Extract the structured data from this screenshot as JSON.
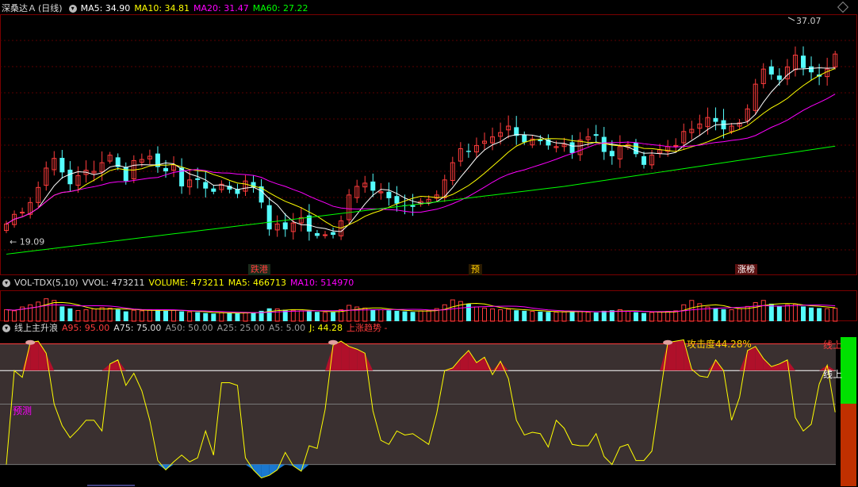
{
  "header": {
    "stock_name": "深桑达Ａ",
    "period": "(日线)",
    "ma5": "MA5: 34.90",
    "ma10": "MA10: 34.81",
    "ma20": "MA20: 31.47",
    "ma60": "MA60: 27.22"
  },
  "price_panel": {
    "high_label": "37.07",
    "low_label": "19.09",
    "events": [
      "跌港",
      "预",
      "涨榜"
    ]
  },
  "volume_header": {
    "indicator": "VOL-TDX(5,10)",
    "vvol": "VVOL: 473211",
    "volume": "VOLUME: 473211",
    "ma5": "MA5: 466713",
    "ma10": "MA10: 514970"
  },
  "indicator_header": {
    "name": "线上主升浪",
    "a95": "A95: 95.00",
    "a75": "A75: 75.00",
    "a50": "A50: 50.00",
    "a25": "A25: 25.00",
    "a5": "A5: 5.00",
    "j": "J: 44.28",
    "trend": "上涨趋势 -"
  },
  "indicator_panel": {
    "attack_label": "攻击度44.28%",
    "line_top_label": "线上",
    "line_label": "线上",
    "predict_label": "预测"
  },
  "colors": {
    "up": "#ff3c3c",
    "down": "#54fcfc",
    "ma5": "#ffffff",
    "ma10": "#ffff00",
    "ma20": "#ff00ff",
    "ma60": "#00ff00"
  },
  "chart_data": {
    "type": "candlestick",
    "price_ylim": [
      17,
      40
    ],
    "closes": [
      20.8,
      21.7,
      21.9,
      22.8,
      24.2,
      26.0,
      26.9,
      25.6,
      24.5,
      25.3,
      25.8,
      25.7,
      26.5,
      27.2,
      26.1,
      24.8,
      26.7,
      26.8,
      27.1,
      26.1,
      25.7,
      26.3,
      24.3,
      24.9,
      24.9,
      24.1,
      23.8,
      24.5,
      24.0,
      23.6,
      24.8,
      24.2,
      22.8,
      20.3,
      20.8,
      20.3,
      20.9,
      21.4,
      20.1,
      19.7,
      19.8,
      19.8,
      21.1,
      23.5,
      24.3,
      24.6,
      23.9,
      23.8,
      23.2,
      22.7,
      22.5,
      22.4,
      22.9,
      23.1,
      23.5,
      24.9,
      26.5,
      27.8,
      27.5,
      28.1,
      28.5,
      28.9,
      29.3,
      29.9,
      29.0,
      28.4,
      28.7,
      28.5,
      28.1,
      28.0,
      28.2,
      27.4,
      28.6,
      28.9,
      29.0,
      27.5,
      27.1,
      28.0,
      28.2,
      27.3,
      26.3,
      27.2,
      27.7,
      28.0,
      28.1,
      29.4,
      29.6,
      30.1,
      30.7,
      30.3,
      29.6,
      29.9,
      30.2,
      31.5,
      33.8,
      35.2,
      34.7,
      34.2,
      35.4,
      36.5,
      35.3,
      34.9,
      34.5,
      35.2,
      36.6
    ],
    "volume_ylim": [
      0,
      1100000
    ],
    "volumes": [
      420000,
      380000,
      520000,
      600000,
      700000,
      820000,
      760000,
      540000,
      470000,
      390000,
      420000,
      450000,
      500000,
      480000,
      430000,
      360000,
      400000,
      380000,
      420000,
      410000,
      380000,
      400000,
      360000,
      340000,
      330000,
      300000,
      280000,
      310000,
      300000,
      290000,
      320000,
      310000,
      380000,
      470000,
      450000,
      420000,
      400000,
      380000,
      360000,
      340000,
      320000,
      330000,
      420000,
      580000,
      520000,
      480000,
      430000,
      420000,
      400000,
      380000,
      360000,
      340000,
      380000,
      400000,
      460000,
      600000,
      780000,
      720000,
      640000,
      520000,
      480000,
      450000,
      420000,
      440000,
      400000,
      380000,
      360000,
      350000,
      340000,
      330000,
      340000,
      380000,
      360000,
      330000,
      320000,
      380000,
      400000,
      420000,
      360000,
      330000,
      300000,
      320000,
      340000,
      360000,
      380000,
      600000,
      760000,
      640000,
      520000,
      480000,
      440000,
      420000,
      460000,
      540000,
      680000,
      760000,
      640000,
      560000,
      600000,
      620000,
      540000,
      500000,
      480000,
      460000,
      473211
    ],
    "indicator_ylim": [
      -10,
      100
    ],
    "j_values": [
      5,
      75,
      70,
      96,
      97,
      88,
      50,
      34,
      25,
      31,
      38,
      38,
      30,
      80,
      83,
      64,
      73,
      60,
      38,
      8,
      1,
      7,
      12,
      7,
      10,
      30,
      12,
      66,
      66,
      64,
      10,
      1,
      -5,
      -3,
      1,
      14,
      4,
      0,
      19,
      17,
      46,
      94,
      97,
      93,
      91,
      88,
      45,
      23,
      20,
      30,
      27,
      28,
      24,
      20,
      43,
      75,
      77,
      84,
      90,
      81,
      85,
      72,
      82,
      69,
      38,
      27,
      29,
      28,
      18,
      38,
      32,
      20,
      19,
      19,
      28,
      11,
      5,
      18,
      20,
      8,
      8,
      15,
      55,
      96,
      97,
      98,
      76,
      71,
      70,
      83,
      75,
      38,
      55,
      90,
      93,
      84,
      78,
      80,
      83,
      40,
      30,
      35,
      65,
      79,
      44
    ]
  }
}
